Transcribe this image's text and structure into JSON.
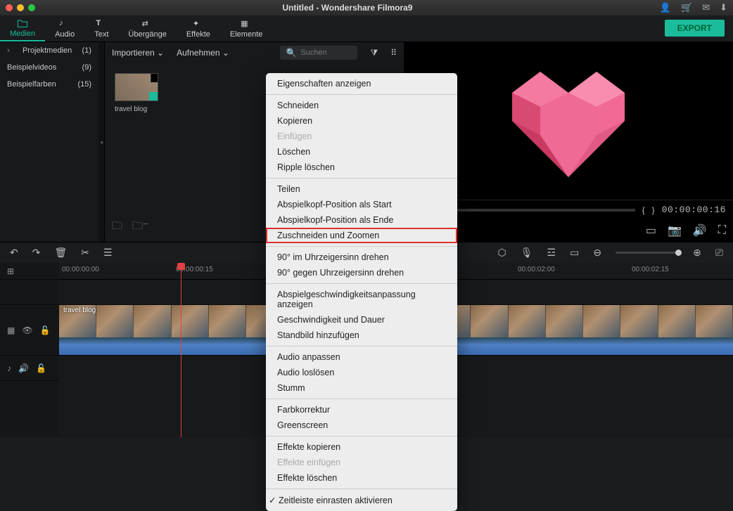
{
  "titlebar": {
    "title": "Untitled - Wondershare Filmora9"
  },
  "tabs": {
    "media": "Medien",
    "audio": "Audio",
    "text": "Text",
    "transitions": "Übergänge",
    "effects": "Effekte",
    "elements": "Elemente"
  },
  "export_label": "EXPORT",
  "sidebar": {
    "items": [
      {
        "label": "Projektmedien",
        "count": "(1)"
      },
      {
        "label": "Beispielvideos",
        "count": "(9)"
      },
      {
        "label": "Beispielfarben",
        "count": "(15)"
      }
    ]
  },
  "media_toolbar": {
    "import": "Importieren",
    "record": "Aufnehmen",
    "search_placeholder": "Suchen"
  },
  "thumb": {
    "label": "travel blog"
  },
  "preview": {
    "timecode": "00:00:00:16",
    "mark_in": "{",
    "mark_out": "}"
  },
  "ruler": {
    "t0": "00:00:00:00",
    "t1": "00:00:00:15",
    "t2": "00:00:02:00",
    "t3": "00:00:02:15"
  },
  "clip": {
    "label": "travel blog"
  },
  "ctx": {
    "show_props": "Eigenschaften anzeigen",
    "cut": "Schneiden",
    "copy": "Kopieren",
    "paste": "Einfügen",
    "delete": "Löschen",
    "ripple_delete": "Ripple löschen",
    "split": "Teilen",
    "play_start": "Abspielkopf-Position als Start",
    "play_end": "Abspielkopf-Position als Ende",
    "crop_zoom": "Zuschneiden und Zoomen",
    "rot_cw": "90° im Uhrzeigersinn drehen",
    "rot_ccw": "90° gegen Uhrzeigersinn drehen",
    "speed_adj": "Abspielgeschwindigkeitsanpassung anzeigen",
    "speed_dur": "Geschwindigkeit und Dauer",
    "freeze": "Standbild hinzufügen",
    "audio_adj": "Audio anpassen",
    "audio_detach": "Audio loslösen",
    "mute": "Stumm",
    "color_corr": "Farbkorrektur",
    "greenscreen": "Greenscreen",
    "fx_copy": "Effekte kopieren",
    "fx_paste": "Effekte einfügen",
    "fx_delete": "Effekte löschen",
    "snap": "Zeitleiste einrasten aktivieren"
  }
}
